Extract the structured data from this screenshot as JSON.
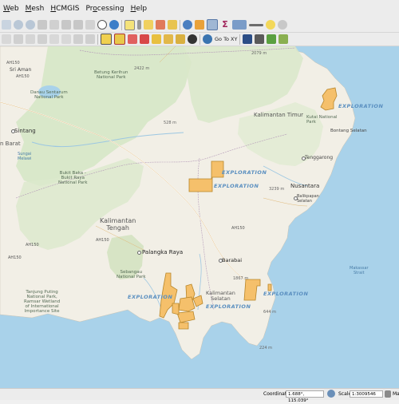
{
  "menu": {
    "items": [
      "Web",
      "Mesh",
      "HCMGIS",
      "Processing",
      "Help"
    ],
    "underline": [
      "W",
      "M",
      "H",
      "o",
      "H"
    ]
  },
  "toolbar": {
    "goto_label": "Go To XY"
  },
  "map": {
    "labels": {
      "malaysia_road": "AH150",
      "sri_aman": "Sri Aman",
      "road_a": "AH150",
      "betung": "Betung Kerihun\nNational Park",
      "elev_2422": "2422 m",
      "elev_2079": "2079 m",
      "danau": "Danau Sentarum\nNational Park",
      "sintang": "Sintang",
      "barat": "n Barat",
      "sungai": "Sungai\nMelawi",
      "kaltim": "Kalimantan Timur",
      "kutai": "Kutai National\nPark",
      "bontang": "Bontang Selatan",
      "tenggarong": "Tenggarong",
      "nusantara": "Nusantara",
      "balikpapan": "Balikpapan\nSelatan",
      "elev_528": "528 m",
      "elev_3239": "3239 m",
      "bukit": "Bukit Baka -\nBukit Raya\nNational Park",
      "kalteng": "Kalimantan\nTengah",
      "ah150_b": "AH150",
      "ah150_c": "AH150",
      "ah150_d": "AH150",
      "palangka": "Palangka Raya",
      "sebangau": "Sebangau\nNational Park",
      "barabai": "Barabai",
      "elev_1867": "1867 m",
      "kalsel": "Kalimantan\nSelatan",
      "tanjung": "Tanjung Puting\nNational Park,\nRamsar Wetland\nof International\nImportance Site",
      "makassar": "Makassar\nStrait",
      "elev_644": "644 m",
      "elev_224": "224 m",
      "explo_1": "EXPLORATION",
      "explo_2": "EXPLORATION",
      "explo_3": "EXPLORATION",
      "explo_4": "EXPLORATION",
      "explo_5": "EXPLORATION",
      "explo_6": "EXPLORATION"
    },
    "colors": {
      "sea": "#a9d2ea",
      "land": "#f2efe6",
      "forest": "#d8e8c8",
      "block_fill": "#f5c06b",
      "block_stroke": "#b8862a"
    }
  },
  "status": {
    "coordinate_label": "Coordinate",
    "coordinate_value": "1.688°, 115.039°",
    "scale_label": "Scale",
    "scale_value": "1:3009546",
    "mag_label": "Ma"
  }
}
